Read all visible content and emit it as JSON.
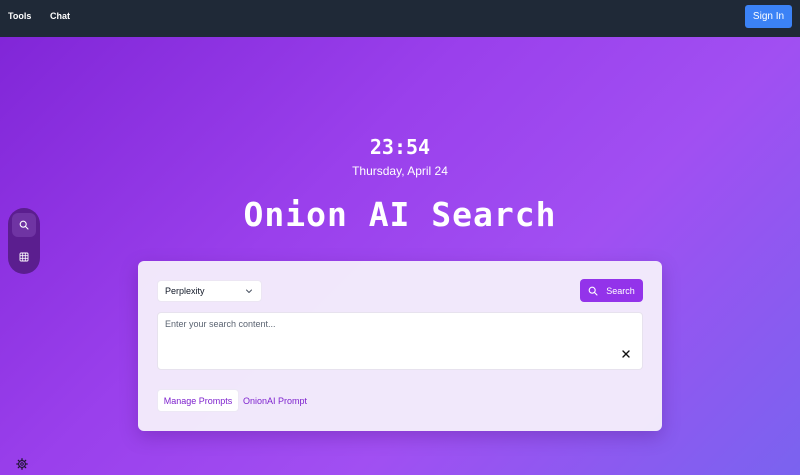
{
  "nav": {
    "links": [
      {
        "label": "Tools"
      },
      {
        "label": "Chat"
      }
    ],
    "signin_label": "Sign In"
  },
  "hero": {
    "time": "23:54",
    "date": "Thursday, April 24",
    "title": "Onion AI Search"
  },
  "sidebar": {
    "items": [
      {
        "icon": "search-icon",
        "active": true
      },
      {
        "icon": "grid-icon",
        "active": false
      }
    ]
  },
  "search_card": {
    "engine_selected": "Perplexity",
    "search_button_label": "Search",
    "query_placeholder": "Enter your search content...",
    "query_value": "",
    "manage_prompts_label": "Manage Prompts",
    "prompt_link_label": "OnionAI Prompt"
  },
  "footer": {
    "settings_icon": "gear-icon"
  },
  "colors": {
    "navbar": "#1f2937",
    "signin": "#3b82f6",
    "accent": "#9333ea",
    "link": "#7e22ce",
    "sidebar": "#5b1e8f"
  }
}
